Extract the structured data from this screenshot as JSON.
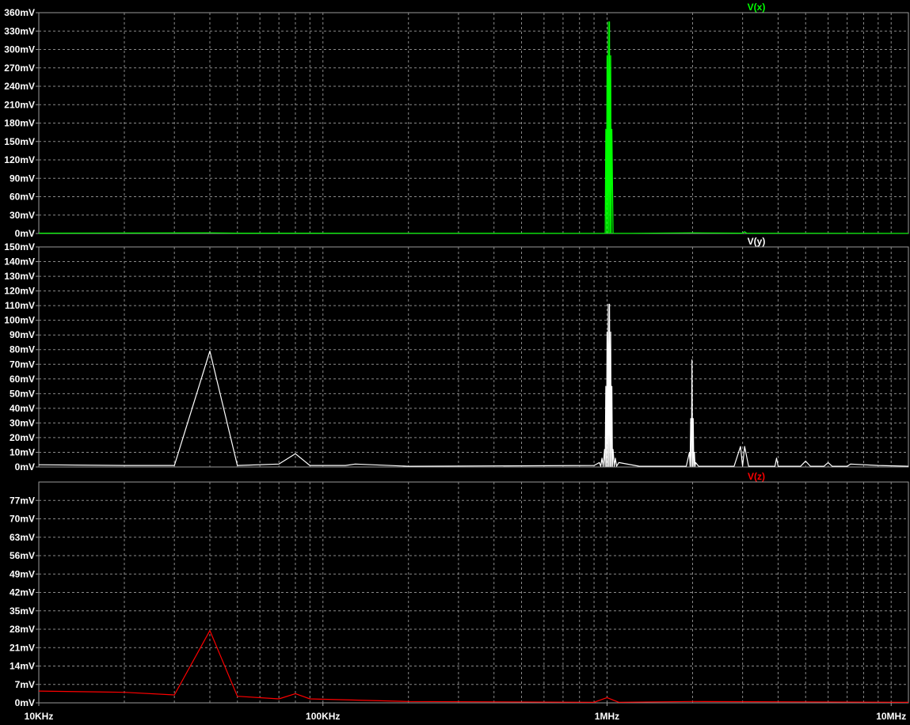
{
  "x_axis": {
    "ticks": [
      {
        "label": "10KHz",
        "value": 10000
      },
      {
        "label": "100KHz",
        "value": 100000
      },
      {
        "label": "1MHz",
        "value": 1000000
      },
      {
        "label": "10MHz",
        "value": 10000000
      }
    ]
  },
  "chart_data": [
    {
      "type": "line",
      "title": "V(x)",
      "color": "#00ff00",
      "xscale": "log",
      "xlim": [
        10000,
        11500000
      ],
      "ylim": [
        0,
        360
      ],
      "grid": true,
      "yticks": [
        "0mV",
        "30mV",
        "60mV",
        "90mV",
        "120mV",
        "150mV",
        "180mV",
        "210mV",
        "240mV",
        "270mV",
        "300mV",
        "330mV",
        "360mV"
      ],
      "x": [
        10000,
        40000,
        50000,
        980000,
        985000,
        990000,
        995000,
        1000000,
        1005000,
        1010000,
        1015000,
        1020000,
        1025000,
        1030000,
        1035000,
        1040000,
        1050000,
        1200000,
        2000000,
        3000000,
        3050000,
        3100000,
        10000000,
        11500000
      ],
      "y": [
        0.5,
        1,
        0.5,
        0.3,
        0.3,
        170,
        0.3,
        290,
        0.3,
        345,
        0.3,
        345,
        0.3,
        290,
        0.3,
        170,
        0.3,
        0.3,
        1,
        0.5,
        3,
        0.5,
        0.3,
        0.3
      ]
    },
    {
      "type": "line",
      "title": "V(y)",
      "color": "#ffffff",
      "xscale": "log",
      "xlim": [
        10000,
        11500000
      ],
      "ylim": [
        0,
        150
      ],
      "grid": true,
      "yticks": [
        "0mV",
        "10mV",
        "20mV",
        "30mV",
        "40mV",
        "50mV",
        "60mV",
        "70mV",
        "80mV",
        "90mV",
        "100mV",
        "110mV",
        "120mV",
        "130mV",
        "140mV",
        "150mV"
      ],
      "x": [
        10000,
        20000,
        30000,
        40000,
        50000,
        70000,
        80000,
        90000,
        120000,
        130000,
        200000,
        900000,
        940000,
        950000,
        960000,
        970000,
        980000,
        985000,
        990000,
        995000,
        1000000,
        1005000,
        1010000,
        1015000,
        1020000,
        1025000,
        1030000,
        1035000,
        1040000,
        1045000,
        1050000,
        1060000,
        1070000,
        1080000,
        1100000,
        1300000,
        1900000,
        1950000,
        1960000,
        1970000,
        1980000,
        1990000,
        2000000,
        2010000,
        2020000,
        2030000,
        2040000,
        2050000,
        2100000,
        2800000,
        2950000,
        3000000,
        3050000,
        3150000,
        3900000,
        3950000,
        4000000,
        4050000,
        4800000,
        5000000,
        5200000,
        5800000,
        6000000,
        6200000,
        7000000,
        7200000,
        9000000,
        11500000
      ],
      "y": [
        1.5,
        1,
        1,
        79,
        1,
        2,
        9,
        1,
        1,
        2,
        0.5,
        1,
        3,
        0.5,
        6,
        0.5,
        12,
        0.5,
        55,
        0.5,
        92,
        0.5,
        111,
        0.5,
        111,
        0.5,
        92,
        0.5,
        55,
        0.5,
        12,
        0.5,
        6,
        0.5,
        3,
        0.5,
        0.5,
        10,
        0.5,
        33,
        0.5,
        73,
        0.5,
        33,
        0.5,
        10,
        0.5,
        3,
        0.5,
        0.5,
        14,
        0.5,
        14,
        0.5,
        0.5,
        6,
        0.5,
        0.5,
        0.5,
        4,
        0.5,
        0.5,
        3,
        0.5,
        0.5,
        2,
        1,
        0.5
      ]
    },
    {
      "type": "line",
      "title": "V(z)",
      "color": "#ff0000",
      "xscale": "log",
      "xlim": [
        10000,
        11500000
      ],
      "ylim": [
        0,
        84
      ],
      "grid": true,
      "yticks": [
        "0mV",
        "7mV",
        "14mV",
        "21mV",
        "28mV",
        "35mV",
        "42mV",
        "49mV",
        "56mV",
        "63mV",
        "70mV",
        "77mV"
      ],
      "x": [
        10000,
        20000,
        30000,
        40000,
        50000,
        70000,
        80000,
        90000,
        200000,
        900000,
        1000000,
        1100000,
        2000000,
        11500000
      ],
      "y": [
        4.5,
        4,
        3,
        27.5,
        2.5,
        1.5,
        3.5,
        1.5,
        0.5,
        0.2,
        2,
        0.2,
        0.5,
        0.2
      ]
    }
  ]
}
